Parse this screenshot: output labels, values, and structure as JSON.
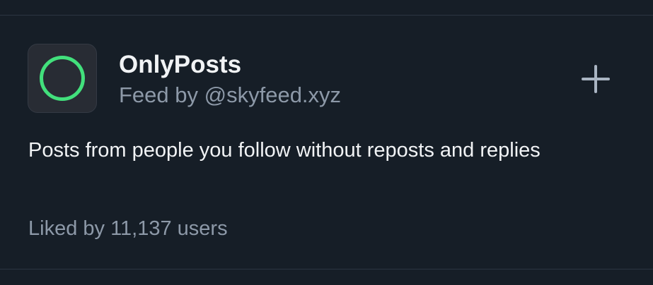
{
  "feed": {
    "title": "OnlyPosts",
    "author_line": "Feed by @skyfeed.xyz",
    "description": "Posts from people you follow without reposts and replies",
    "likes_text": "Liked by 11,137 users",
    "avatar_icon": "green-ring-icon",
    "add_icon": "plus-icon"
  },
  "colors": {
    "background": "#161e27",
    "avatar_bg": "#282c34",
    "ring": "#42e07c",
    "primary_text": "#f1f3f5",
    "secondary_text": "#8d99a8",
    "divider": "#2b3542"
  }
}
